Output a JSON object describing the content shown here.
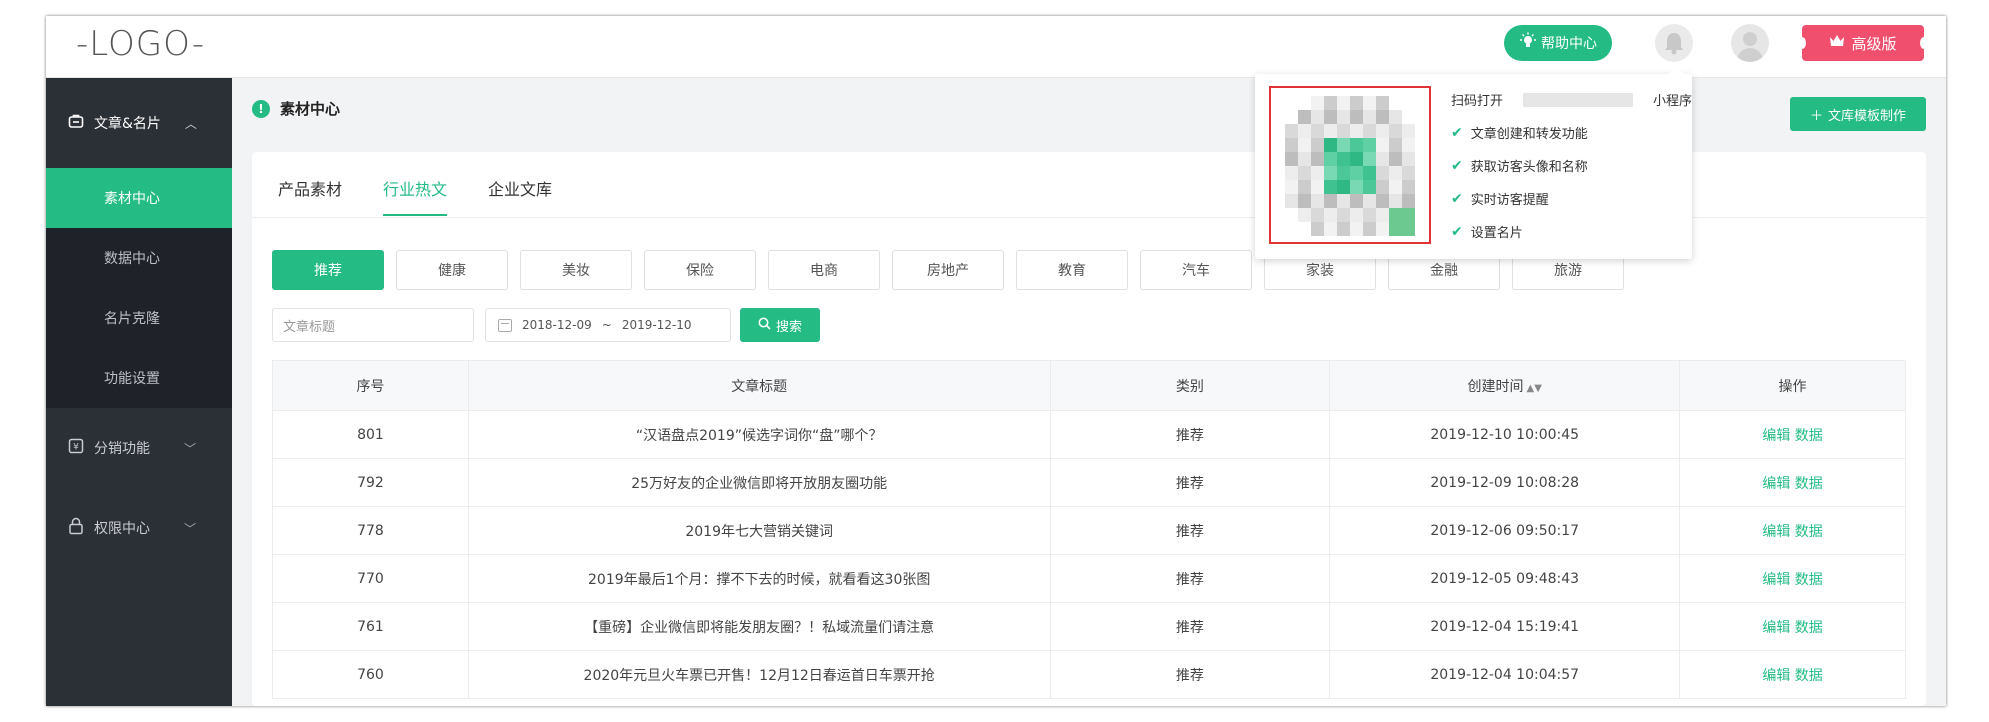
{
  "header": {
    "logo": "-LOGO-",
    "help_label": "帮助中心",
    "pro_label": "高级版"
  },
  "sidebar": {
    "group_label": "文章&名片",
    "sub_items": [
      {
        "label": "素材中心",
        "active": true
      },
      {
        "label": "数据中心",
        "active": false
      },
      {
        "label": "名片克隆",
        "active": false
      },
      {
        "label": "功能设置",
        "active": false
      }
    ],
    "items": [
      {
        "label": "分销功能",
        "icon": "coin-icon"
      },
      {
        "label": "权限中心",
        "icon": "lock-icon"
      }
    ]
  },
  "main": {
    "title": "素材中心",
    "template_button": "文库模板制作",
    "tabs": [
      {
        "label": "产品素材",
        "active": false
      },
      {
        "label": "行业热文",
        "active": true
      },
      {
        "label": "企业文库",
        "active": false
      }
    ],
    "categories": [
      "推荐",
      "健康",
      "美妆",
      "保险",
      "电商",
      "房地产",
      "教育",
      "汽车",
      "家装",
      "金融",
      "旅游"
    ],
    "search": {
      "title_placeholder": "文章标题",
      "date_start": "2018-12-09",
      "date_sep": "~",
      "date_end": "2019-12-10",
      "search_label": "搜索"
    },
    "table": {
      "headers": [
        "序号",
        "文章标题",
        "类别",
        "创建时间",
        "操作"
      ],
      "rows": [
        {
          "id": "801",
          "title": "“汉语盘点2019”候选字词你“盘”哪个？",
          "category": "推荐",
          "created": "2019-12-10 10:00:45"
        },
        {
          "id": "792",
          "title": "25万好友的企业微信即将开放朋友圈功能",
          "category": "推荐",
          "created": "2019-12-09 10:08:28"
        },
        {
          "id": "778",
          "title": "2019年七大营销关键词",
          "category": "推荐",
          "created": "2019-12-06 09:50:17"
        },
        {
          "id": "770",
          "title": "2019年最后1个月：撑不下去的时候，就看看这30张图",
          "category": "推荐",
          "created": "2019-12-05 09:48:43"
        },
        {
          "id": "761",
          "title": "【重磅】企业微信即将能发朋友圈？！私域流量们请注意",
          "category": "推荐",
          "created": "2019-12-04 15:19:41"
        },
        {
          "id": "760",
          "title": "2020年元旦火车票已开售！12月12日春运首日车票开抢",
          "category": "推荐",
          "created": "2019-12-04 10:04:57"
        }
      ],
      "edit_label": "编辑",
      "data_label": "数据"
    }
  },
  "qr_popup": {
    "scan_prefix": "扫码打开",
    "scan_suffix": "小程序",
    "features": [
      "文章创建和转发功能",
      "获取访客头像和名称",
      "实时访客提醒",
      "设置名片"
    ]
  },
  "colors": {
    "accent": "#24bb84",
    "pro": "#f0506e",
    "sidebar": "#2b2f36",
    "qr_border": "#e03333"
  }
}
